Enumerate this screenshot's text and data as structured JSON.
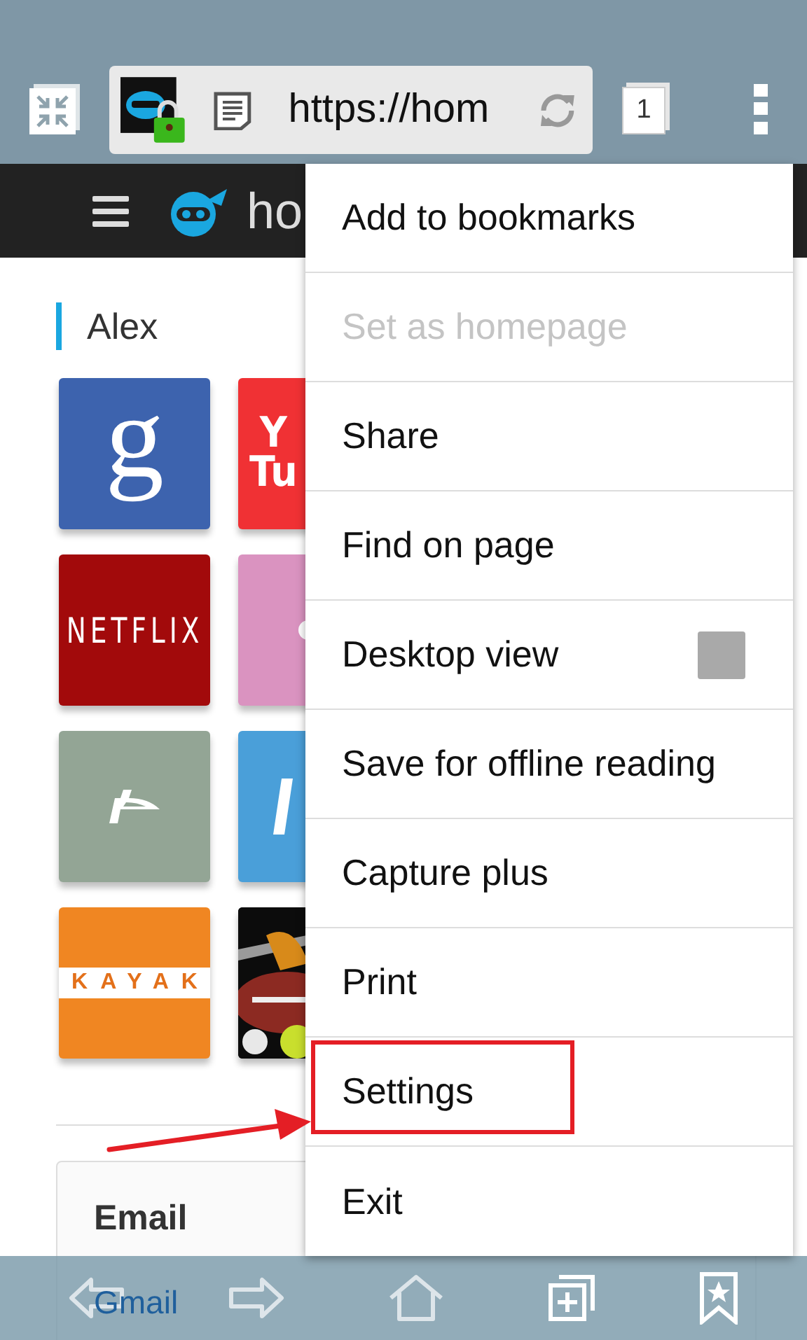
{
  "toolbar": {
    "url": "https://hom",
    "tab_count": "1"
  },
  "page": {
    "logo_text": "ho",
    "section_title": "Alex",
    "tiles": [
      {
        "kind": "letter",
        "color": "#3d63ae",
        "label": "g"
      },
      {
        "kind": "lines",
        "color": "#f03134",
        "lines": [
          "Y",
          "Tu"
        ]
      },
      {
        "kind": "wordmark",
        "color": "#a20a0b",
        "label": "NETFLIX"
      },
      {
        "kind": "dot",
        "color": "#da93c0"
      },
      {
        "kind": "glyph",
        "color": "#93a595"
      },
      {
        "kind": "shard",
        "color": "#4a9fd9"
      },
      {
        "kind": "strip",
        "color": "#f08622",
        "label": "KAYAK"
      },
      {
        "kind": "picture"
      }
    ],
    "card": {
      "title": "Email",
      "link": "Gmail"
    }
  },
  "menu": {
    "items": [
      {
        "label": "Add to bookmarks",
        "disabled": false,
        "highlighted": false
      },
      {
        "label": "Set as homepage",
        "disabled": true,
        "highlighted": false
      },
      {
        "label": "Share",
        "disabled": false,
        "highlighted": false
      },
      {
        "label": "Find on page",
        "disabled": false,
        "highlighted": false
      },
      {
        "label": "Desktop view",
        "disabled": false,
        "highlighted": false,
        "kind": "checkbox",
        "checked": false
      },
      {
        "label": "Save for offline reading",
        "disabled": false,
        "highlighted": false
      },
      {
        "label": "Capture plus",
        "disabled": false,
        "highlighted": false
      },
      {
        "label": "Print",
        "disabled": false,
        "highlighted": false
      },
      {
        "label": "Settings",
        "disabled": false,
        "highlighted": true
      },
      {
        "label": "Exit",
        "disabled": false,
        "highlighted": false
      }
    ]
  }
}
